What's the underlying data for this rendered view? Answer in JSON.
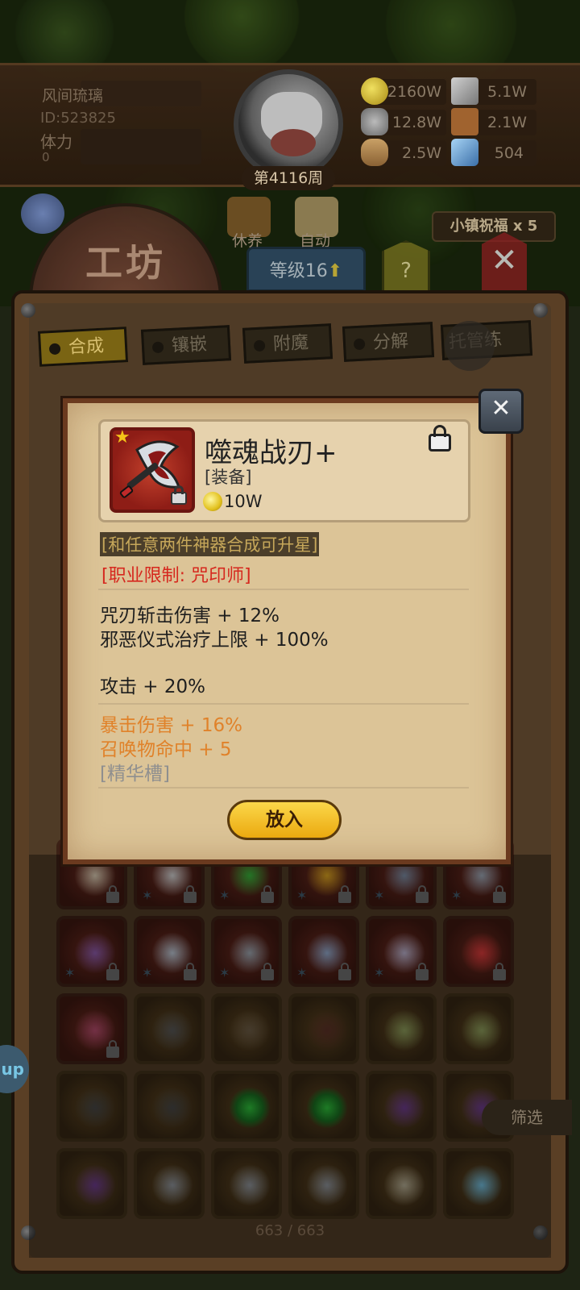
{
  "player": {
    "name": "风间琉璃",
    "id": "ID:523825",
    "stamina_label": "体力",
    "stamina_value": "0",
    "week": "第4116周"
  },
  "resources": [
    {
      "value": "2160W",
      "icon": "gold-coin-icon"
    },
    {
      "value": "5.1W",
      "icon": "iron-ingot-icon"
    },
    {
      "value": "12.8W",
      "icon": "stone-icon"
    },
    {
      "value": "2.1W",
      "icon": "leather-icon"
    },
    {
      "value": "2.5W",
      "icon": "wood-log-icon"
    },
    {
      "value": "504",
      "icon": "crystal-icon"
    }
  ],
  "nav": {
    "rest": "休养",
    "auto": "自动",
    "bless": "小镇祝福 x 5"
  },
  "workshop": {
    "title": "工坊",
    "level": "等级16",
    "help": "?"
  },
  "tabs": [
    "合成",
    "镶嵌",
    "附魔",
    "分解",
    "托管练"
  ],
  "popup": {
    "item_name": "噬魂战刃+",
    "item_category": "[装备]",
    "item_price": "10W",
    "upgrade_note": "[和任意两件神器合成可升星]",
    "restriction": "[职业限制: 咒印师]",
    "stats": [
      "咒刃斩击伤害 + 12%",
      "邪恶仪式治疗上限 + 100%"
    ],
    "attack": "攻击 + 20%",
    "bonus": [
      "暴击伤害 + 16%",
      "召唤物命中 + 5"
    ],
    "essence_slot": "[精华槽]",
    "put_button": "放入"
  },
  "inventory_count": "663 / 663",
  "filter": "筛选",
  "side_button": "up",
  "colors": {
    "accent_gold": "#f2c22a",
    "restriction_red": "#d6281e",
    "bonus_orange": "#e0822a"
  }
}
